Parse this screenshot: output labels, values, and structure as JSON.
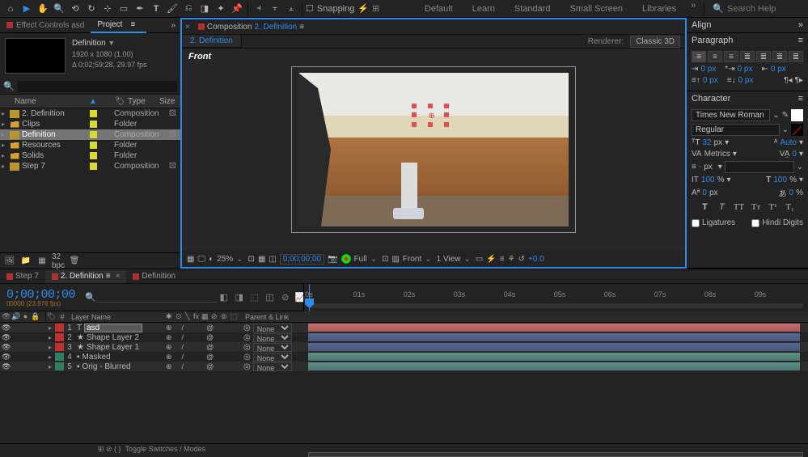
{
  "toolbar": {
    "snapping_label": "Snapping",
    "workspaces": [
      "Default",
      "Learn",
      "Standard",
      "Small Screen",
      "Libraries"
    ],
    "search_placeholder": "Search Help"
  },
  "project": {
    "tabs": {
      "effect_controls": "Effect Controls asd",
      "project": "Project"
    },
    "comp_name": "Definition",
    "comp_size": "1920 x 1080 (1.00)",
    "comp_dur": "Δ 0;02;59;28, 29.97 fps",
    "columns": {
      "name": "Name",
      "comment": "Comment",
      "type": "Type",
      "size": "Size"
    },
    "items": [
      {
        "name": "2. Definition",
        "type": "Composition",
        "kind": "comp",
        "sel": false
      },
      {
        "name": "Clips",
        "type": "Folder",
        "kind": "folder",
        "sel": false
      },
      {
        "name": "Definition",
        "type": "Composition",
        "kind": "comp",
        "sel": true
      },
      {
        "name": "Resources",
        "type": "Folder",
        "kind": "folder",
        "sel": false
      },
      {
        "name": "Solids",
        "type": "Folder",
        "kind": "folder",
        "sel": false
      },
      {
        "name": "Step 7",
        "type": "Composition",
        "kind": "comp",
        "sel": false
      }
    ],
    "bpc": "32 bpc"
  },
  "comp_panel": {
    "tab_prefix": "Composition",
    "tab_name": "2. Definition",
    "subview": "2. Definition",
    "renderer_label": "Renderer:",
    "renderer": "Classic 3D",
    "view_name": "Front",
    "footer": {
      "zoom": "25%",
      "tc": "0;00;00;00",
      "res": "Full",
      "view_dd": "Front",
      "views": "1 View",
      "exp": "+0.0"
    }
  },
  "align_panel": {
    "title": "Align"
  },
  "para_panel": {
    "title": "Paragraph",
    "indent_l": "0 px",
    "indent_r": "0 px",
    "indent_fl": "0 px",
    "space_b": "0 px",
    "space_a": "0 px"
  },
  "char_panel": {
    "title": "Character",
    "font": "Times New Roman",
    "style": "Regular",
    "size": "32",
    "size_u": "px",
    "leading": "Auto",
    "kerning": "Metrics",
    "tracking": "0",
    "stroke_w": "-",
    "stroke_u": "px",
    "vscale": "100",
    "hscale": "100",
    "scale_u": "%",
    "baseline": "0",
    "baseline_u": "px",
    "tsume": "0",
    "tsume_u": "%",
    "ligatures": "Ligatures",
    "hindi": "Hindi Digits"
  },
  "timeline": {
    "tabs": [
      {
        "label": "Step 7",
        "active": false,
        "closable": false
      },
      {
        "label": "2. Definition",
        "active": true,
        "closable": true
      },
      {
        "label": "Definition",
        "active": false,
        "closable": false
      }
    ],
    "tc": "0;00;00;00",
    "tc_sub": "00000 (23.976 fps)",
    "ruler": [
      "0s",
      "01s",
      "02s",
      "03s",
      "04s",
      "05s",
      "06s",
      "07s",
      "08s",
      "09s"
    ],
    "cols": {
      "num": "#",
      "name": "Layer Name",
      "parent": "Parent & Link"
    },
    "layers": [
      {
        "n": "1",
        "name": "asd",
        "parent": "None",
        "color": "#c03030",
        "bar": "red",
        "editing": true
      },
      {
        "n": "2",
        "name": "Shape Layer 2",
        "parent": "None",
        "color": "#c03030",
        "bar": "blue",
        "star": true
      },
      {
        "n": "3",
        "name": "Shape Layer 1",
        "parent": "None",
        "color": "#c03030",
        "bar": "blue",
        "star": true
      },
      {
        "n": "4",
        "name": "Masked",
        "parent": "None",
        "color": "#308060",
        "bar": "teal"
      },
      {
        "n": "5",
        "name": "Orig - Blurred",
        "parent": "None",
        "color": "#308060",
        "bar": "teal"
      }
    ],
    "footer_label": "Toggle Switches / Modes"
  }
}
